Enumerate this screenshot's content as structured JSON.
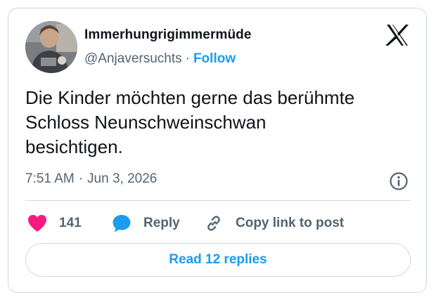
{
  "author": {
    "display_name": "Immerhungrigimmermüde",
    "handle": "@Anjaversuchts",
    "separator": "·",
    "follow_label": "Follow",
    "avatar_icon": "profile-photo"
  },
  "brand": {
    "logo_icon": "x-logo-icon"
  },
  "tweet": {
    "text": "Die Kinder möchten gerne das berühmte\nSchloss Neunschweinschwan\nbesichtigen.",
    "time": "7:51 AM",
    "separator": "·",
    "date": "Jun 3, 2026",
    "info_icon": "info-icon"
  },
  "actions": {
    "like_count": "141",
    "reply_label": "Reply",
    "copy_label": "Copy link to post"
  },
  "replies_button": {
    "label": "Read 12 replies"
  },
  "colors": {
    "accent": "#1d9bf0",
    "like": "#f91880",
    "text": "#0f1419",
    "secondary": "#536471",
    "border": "#cfd9de"
  }
}
